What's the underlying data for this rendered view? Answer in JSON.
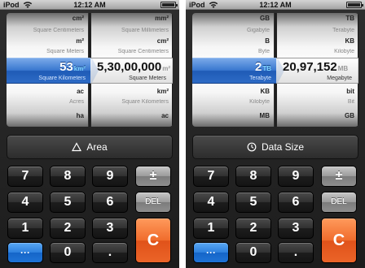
{
  "screens": [
    {
      "status": {
        "carrier": "iPod",
        "time": "12:12 AM"
      },
      "left_wheel": {
        "rows": [
          {
            "text": "cm²",
            "style": "abbr"
          },
          {
            "text": "Square Centimeters",
            "style": "name"
          },
          {
            "text": "m²",
            "style": "abbr"
          },
          {
            "text": "Square Meters",
            "style": "name"
          },
          {
            "text": "ac",
            "style": "abbr"
          },
          {
            "text": "Acres",
            "style": "name"
          },
          {
            "text": "ha",
            "style": "abbr"
          }
        ]
      },
      "right_wheel": {
        "rows": [
          {
            "text": "mm²",
            "style": "abbr"
          },
          {
            "text": "Square Millimeters",
            "style": "name"
          },
          {
            "text": "cm²",
            "style": "abbr"
          },
          {
            "text": "Square Centimeters",
            "style": "name"
          },
          {
            "text": "km²",
            "style": "abbr"
          },
          {
            "text": "Square Kilometers",
            "style": "name"
          },
          {
            "text": "ac",
            "style": "abbr"
          }
        ]
      },
      "input": {
        "value": "53",
        "unit": "km²",
        "unit_name": "Square Kilometers"
      },
      "output": {
        "value": "5,30,00,000",
        "unit": "m²",
        "unit_name": "Square Meters"
      },
      "category": {
        "label": "Area",
        "icon": "triangle-icon"
      },
      "keys": {
        "k7": "7",
        "k8": "8",
        "k9": "9",
        "sign": "±",
        "k4": "4",
        "k5": "5",
        "k6": "6",
        "del": "DEL",
        "k1": "1",
        "k2": "2",
        "k3": "3",
        "clear": "C",
        "more": "···",
        "k0": "0",
        "dot": "."
      }
    },
    {
      "status": {
        "carrier": "iPod",
        "time": "12:12 AM"
      },
      "left_wheel": {
        "rows": [
          {
            "text": "GB",
            "style": "abbr"
          },
          {
            "text": "Gigabyte",
            "style": "name"
          },
          {
            "text": "B",
            "style": "abbr"
          },
          {
            "text": "Byte",
            "style": "name"
          },
          {
            "text": "KB",
            "style": "abbr"
          },
          {
            "text": "Kilobyte",
            "style": "name"
          },
          {
            "text": "MB",
            "style": "abbr"
          }
        ]
      },
      "right_wheel": {
        "rows": [
          {
            "text": "TB",
            "style": "abbr"
          },
          {
            "text": "Terabyte",
            "style": "name"
          },
          {
            "text": "KB",
            "style": "abbr"
          },
          {
            "text": "Kilobyte",
            "style": "name"
          },
          {
            "text": "bit",
            "style": "abbr"
          },
          {
            "text": "Bit",
            "style": "name"
          },
          {
            "text": "GB",
            "style": "abbr"
          }
        ]
      },
      "input": {
        "value": "2",
        "unit": "TB",
        "unit_name": "Terabyte"
      },
      "output": {
        "value": "20,97,152",
        "unit": "MB",
        "unit_name": "Megabyte"
      },
      "category": {
        "label": "Data Size",
        "icon": "clock-icon"
      },
      "keys": {
        "k7": "7",
        "k8": "8",
        "k9": "9",
        "sign": "±",
        "k4": "4",
        "k5": "5",
        "k6": "6",
        "del": "DEL",
        "k1": "1",
        "k2": "2",
        "k3": "3",
        "clear": "C",
        "more": "···",
        "k0": "0",
        "dot": "."
      }
    }
  ],
  "colors": {
    "accent_blue": "#2c7fdd",
    "clear_orange": "#f06c2c",
    "unit_cyan": "#7fd6ff"
  }
}
